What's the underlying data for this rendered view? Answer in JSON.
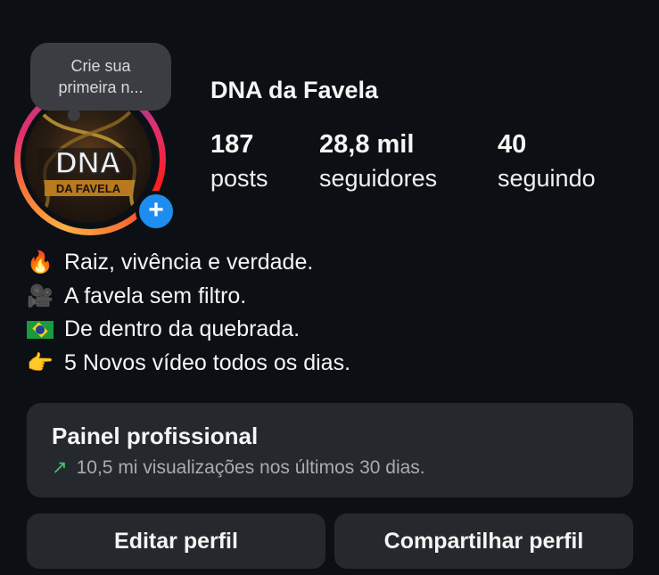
{
  "profile": {
    "username": "DNA da Favela",
    "note_line1": "Crie sua",
    "note_line2": "primeira n...",
    "avatar_logo_top": "DNA",
    "avatar_logo_bottom": "DA FAVELA",
    "add_icon": "+"
  },
  "stats": {
    "posts_count": "187",
    "posts_label": "posts",
    "followers_count": "28,8 mil",
    "followers_label": "seguidores",
    "following_count": "40",
    "following_label": "seguindo"
  },
  "bio": {
    "lines": [
      {
        "emoji": "🔥",
        "icon": "fire-icon",
        "text": "Raiz, vivência e verdade."
      },
      {
        "emoji": "🎥",
        "icon": "movie-camera-icon",
        "text": "A favela sem filtro."
      },
      {
        "emoji": "",
        "icon": "brazil-flag-icon",
        "text": "De dentro da quebrada."
      },
      {
        "emoji": "👉",
        "icon": "pointing-hand-icon",
        "text": "5 Novos vídeo todos os dias."
      }
    ]
  },
  "panel": {
    "title": "Painel profissional",
    "arrow": "↗",
    "subtitle": "10,5 mi visualizações nos últimos 30 dias."
  },
  "buttons": {
    "edit_label": "Editar perfil",
    "share_label": "Compartilhar perfil"
  },
  "colors": {
    "background": "#0c1014",
    "panel": "#25282d",
    "badge_blue": "#1d8df0",
    "trend_green": "#3ec76b"
  }
}
